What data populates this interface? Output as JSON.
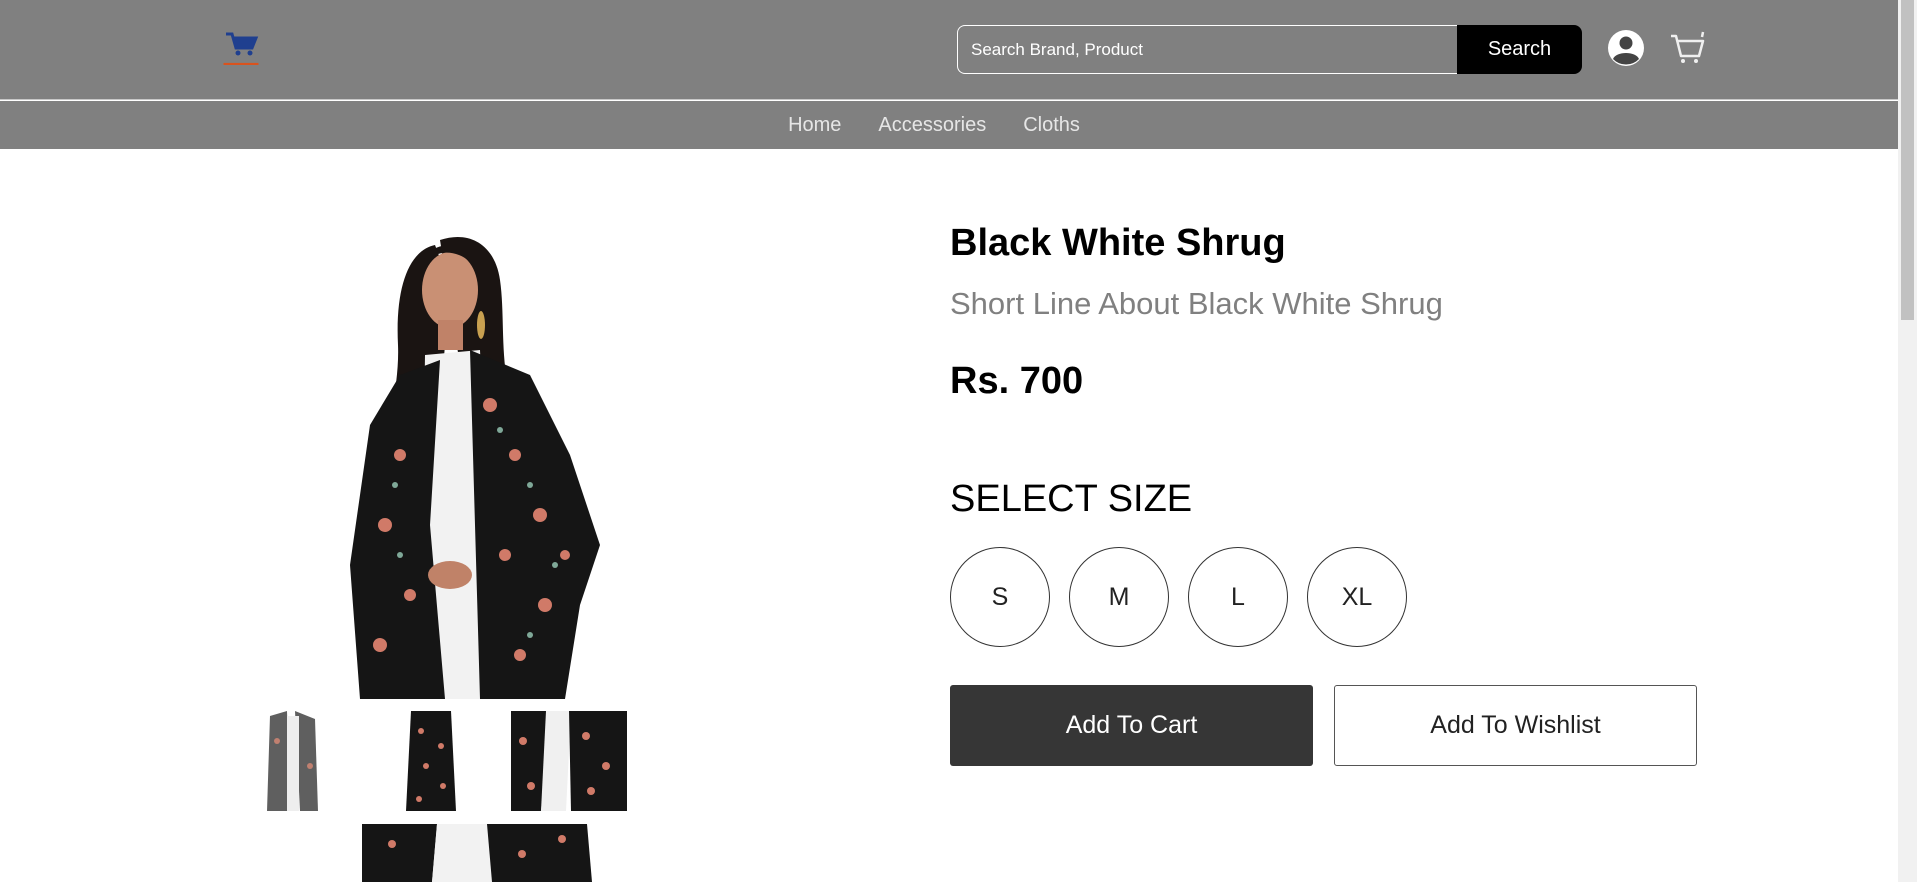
{
  "header": {
    "logo_icon": "shopping-cart-logo",
    "search": {
      "placeholder": "Search Brand, Product",
      "value": "",
      "button_label": "Search"
    },
    "account_icon": "user-account-icon",
    "cart_icon": "cart-icon"
  },
  "nav": {
    "items": [
      {
        "label": "Home"
      },
      {
        "label": "Accessories"
      },
      {
        "label": "Cloths"
      }
    ]
  },
  "product": {
    "title": "Black White Shrug",
    "subtitle": "Short Line About Black White Shrug",
    "price": "Rs. 700",
    "size_heading": "SELECT SIZE",
    "sizes": [
      "S",
      "M",
      "L",
      "XL"
    ],
    "add_to_cart_label": "Add To Cart",
    "add_to_wishlist_label": "Add To Wishlist"
  },
  "colors": {
    "header_bg": "#808080",
    "search_button_bg": "#000000",
    "add_to_cart_bg": "#363636",
    "logo_blue": "#1f3f8f",
    "logo_orange": "#d9531e"
  }
}
